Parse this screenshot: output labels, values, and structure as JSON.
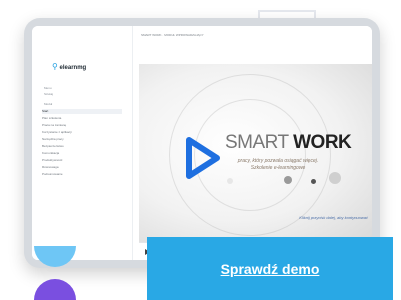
{
  "sidebar": {
    "logo_text": "elearnmg",
    "menu_heading": "Menu",
    "search_label": "Szukaj",
    "section_label": "Moduł",
    "items": [
      {
        "label": "Start"
      },
      {
        "label": "Plan szkolenia"
      },
      {
        "label": "Praca na zamianę"
      },
      {
        "label": "Korzystanie z aplikacji"
      },
      {
        "label": "Narzędzia pracy"
      },
      {
        "label": "Bezpieczeństwo"
      },
      {
        "label": "Komunikacja"
      },
      {
        "label": "Produktywność"
      },
      {
        "label": "Równowaga"
      },
      {
        "label": "Podsumowanie"
      }
    ]
  },
  "header": {
    "breadcrumb": "SMART WORK · MODUŁ WPROWADZAJĄCY"
  },
  "video": {
    "brand_thin": "SMART",
    "brand_bold": "WORK",
    "tagline_pre": "pracy, który pozwala osiągać więcej.",
    "tagline_post": "Szkolenie e-learningowe",
    "tagline_highlight": "pozwala",
    "caption": "Kliknij przycisk dalej, aby kontynuować"
  },
  "cta": {
    "label": "Sprawdź demo"
  },
  "colors": {
    "accent": "#29a8e5",
    "play_icon": "#1e6fe0",
    "deco_top": "#6ec6f5",
    "deco_bottom": "#7a4fe0"
  }
}
